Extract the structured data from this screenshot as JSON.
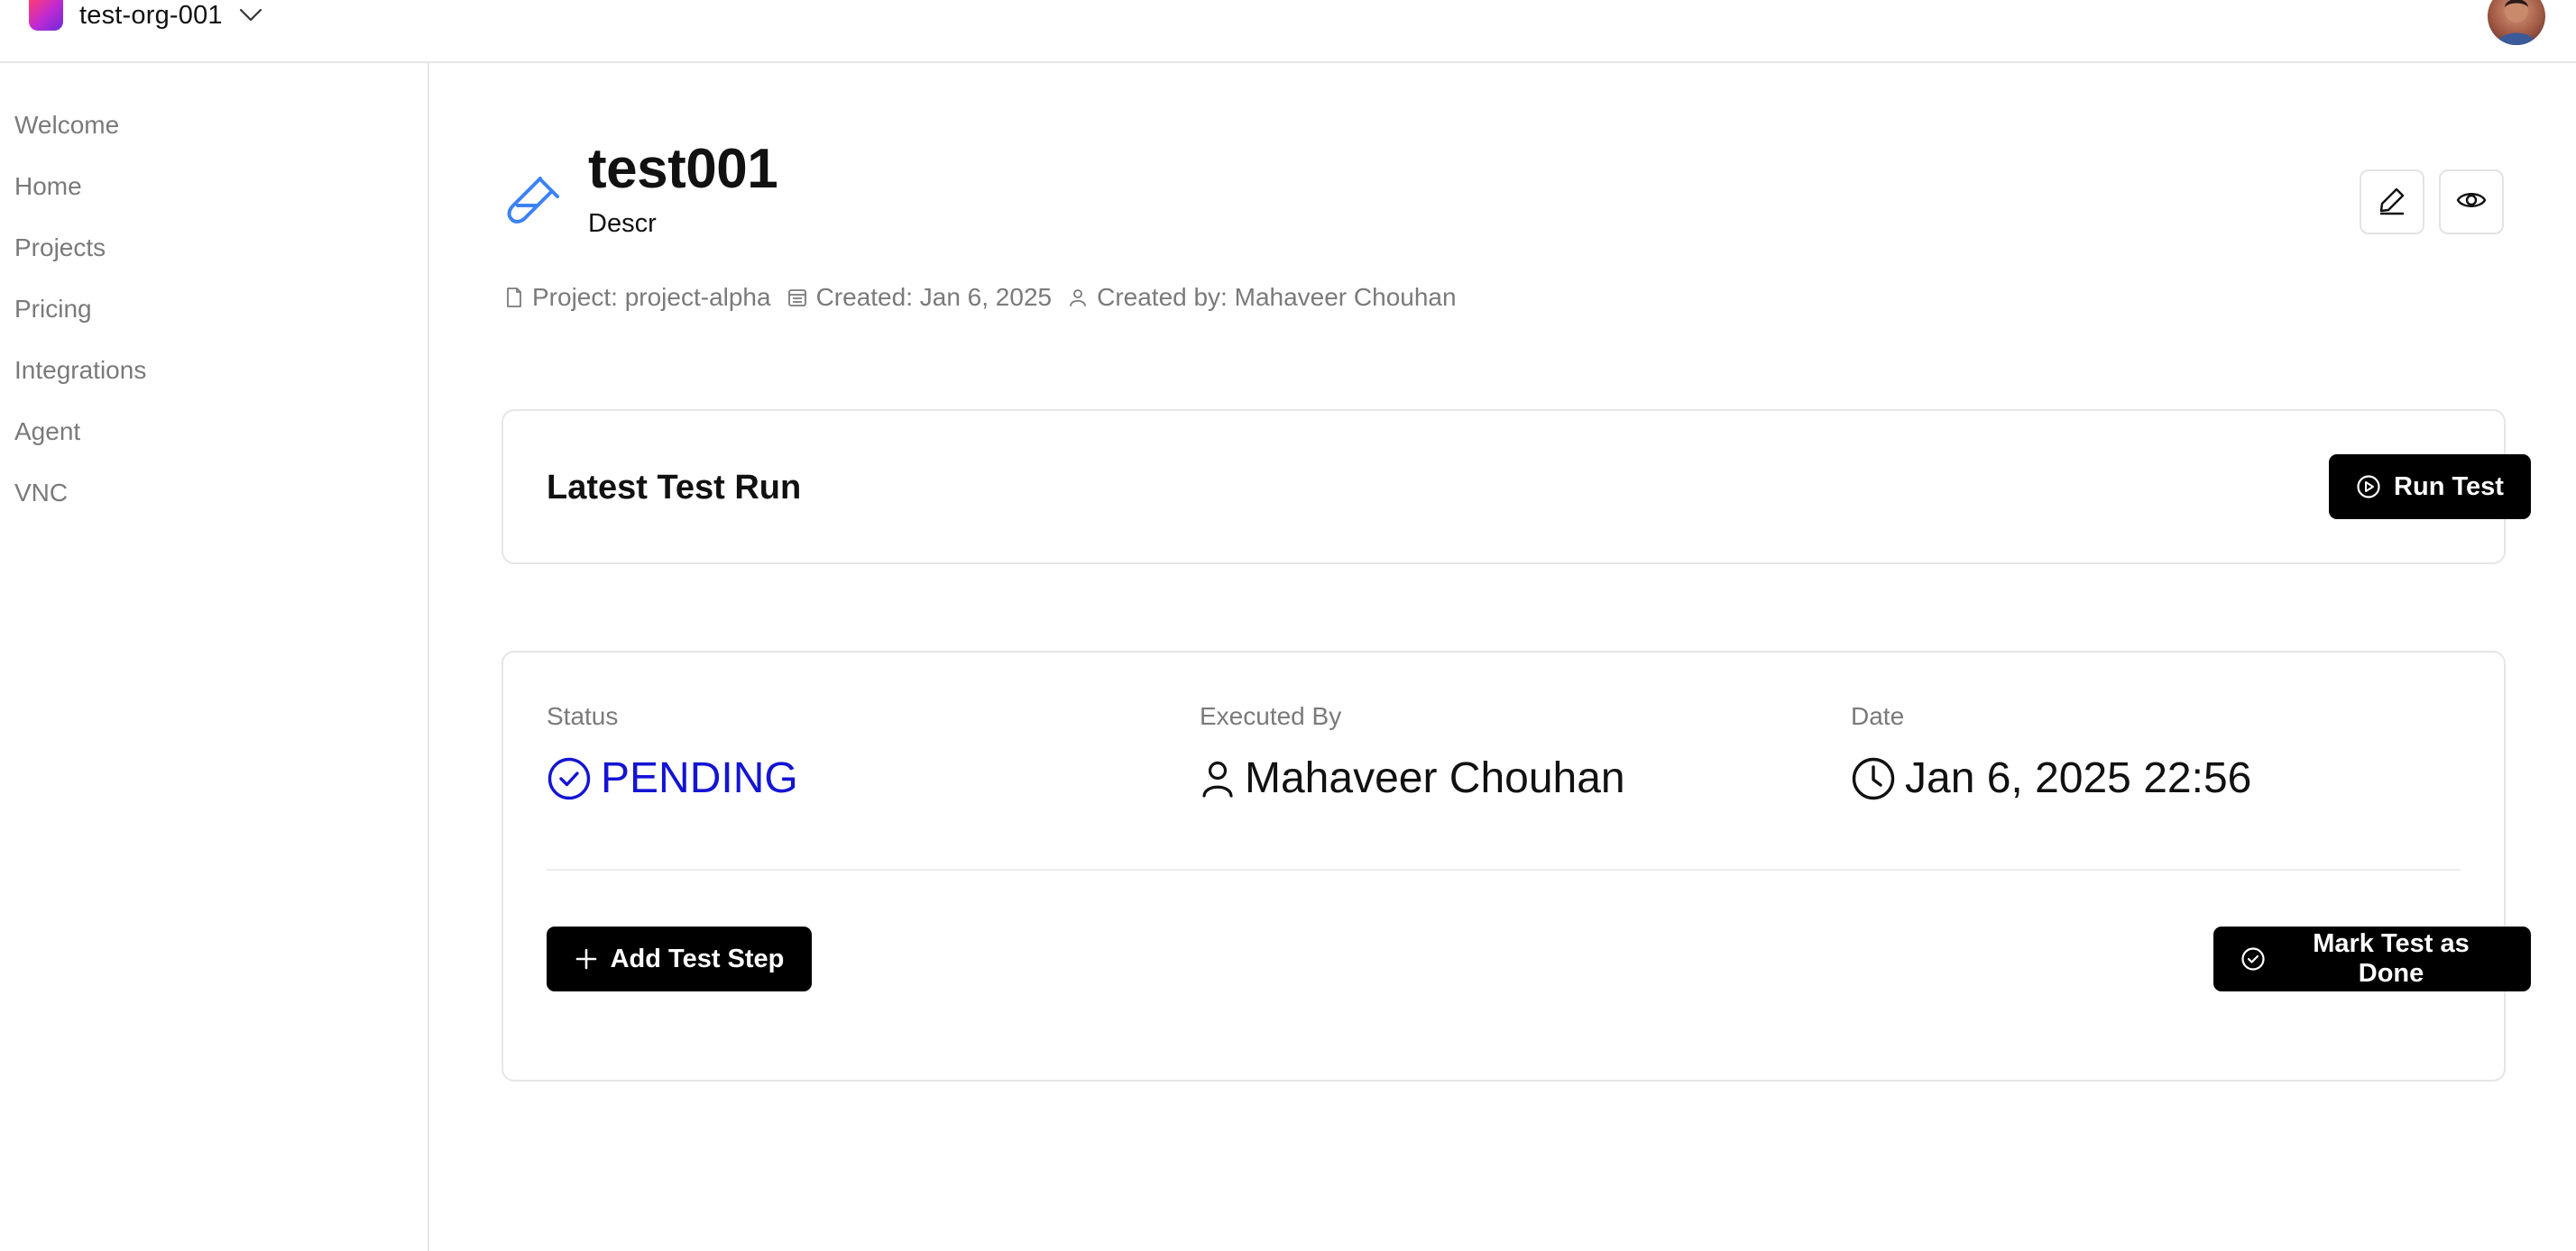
{
  "topbar": {
    "org_name": "test-org-001"
  },
  "sidebar": {
    "items": [
      {
        "label": "Welcome"
      },
      {
        "label": "Home"
      },
      {
        "label": "Projects"
      },
      {
        "label": "Pricing"
      },
      {
        "label": "Integrations"
      },
      {
        "label": "Agent"
      },
      {
        "label": "VNC"
      }
    ]
  },
  "test": {
    "title": "test001",
    "description": "Descr",
    "meta": {
      "project": "Project: project-alpha",
      "created": "Created: Jan 6, 2025",
      "created_by": "Created by: Mahaveer Chouhan"
    }
  },
  "latest_run": {
    "title": "Latest Test Run",
    "run_button": "Run Test"
  },
  "status_card": {
    "status_label": "Status",
    "status_value": "PENDING",
    "executed_by_label": "Executed By",
    "executed_by_value": "Mahaveer Chouhan",
    "date_label": "Date",
    "date_value": "Jan 6, 2025 22:56",
    "add_step_button": "Add Test Step",
    "mark_done_button": "Mark Test as Done"
  },
  "colors": {
    "accent_blue": "#1414d4",
    "icon_blue": "#3b82f6",
    "button_dark": "#000000",
    "muted_text": "#7a7a7a"
  },
  "icons": {
    "org_chevron": "chevron-down-icon",
    "header": "test-tube-icon",
    "edit": "pencil-icon",
    "view": "eye-icon",
    "project": "file-icon",
    "created": "calendar-icon",
    "created_by": "user-icon",
    "run": "play-circle-icon",
    "status": "check-circle-icon",
    "executed_by": "user-icon",
    "date": "clock-icon",
    "add_step": "plus-icon",
    "mark_done": "check-circle-icon"
  }
}
